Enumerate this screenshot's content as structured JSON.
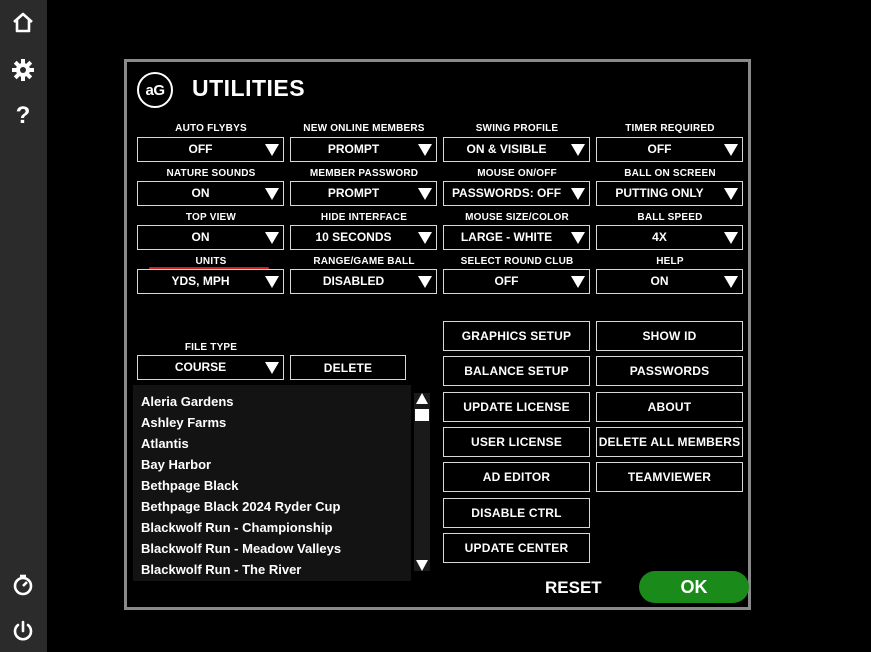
{
  "sidebar": {
    "icons": [
      "home-icon",
      "gear-icon",
      "help-icon",
      "timer-icon",
      "power-icon"
    ],
    "help_glyph": "?"
  },
  "header": {
    "logo_text": "aG",
    "title": "UTILITIES"
  },
  "settings": [
    {
      "label": "AUTO FLYBYS",
      "value": "OFF"
    },
    {
      "label": "NEW ONLINE MEMBERS",
      "value": "PROMPT"
    },
    {
      "label": "SWING PROFILE",
      "value": "ON & VISIBLE"
    },
    {
      "label": "TIMER REQUIRED",
      "value": "OFF"
    },
    {
      "label": "NATURE SOUNDS",
      "value": "ON"
    },
    {
      "label": "MEMBER PASSWORD",
      "value": "PROMPT"
    },
    {
      "label": "MOUSE ON/OFF",
      "value": "PASSWORDS: OFF"
    },
    {
      "label": "BALL ON SCREEN",
      "value": "PUTTING ONLY"
    },
    {
      "label": "TOP VIEW",
      "value": "ON"
    },
    {
      "label": "HIDE INTERFACE",
      "value": "10 SECONDS"
    },
    {
      "label": "MOUSE SIZE/COLOR",
      "value": "LARGE - WHITE"
    },
    {
      "label": "BALL SPEED",
      "value": "4X"
    },
    {
      "label": "UNITS",
      "value": "YDS, MPH"
    },
    {
      "label": "RANGE/GAME BALL",
      "value": "DISABLED"
    },
    {
      "label": "SELECT ROUND CLUB",
      "value": "OFF"
    },
    {
      "label": "HELP",
      "value": "ON"
    }
  ],
  "file_type": {
    "label": "FILE TYPE",
    "value": "COURSE",
    "delete_label": "DELETE"
  },
  "course_list": [
    "Aleria Gardens",
    "Ashley Farms",
    "Atlantis",
    "Bay Harbor",
    "Bethpage Black",
    "Bethpage Black 2024 Ryder Cup",
    "Blackwolf Run - Championship",
    "Blackwolf Run - Meadow Valleys",
    "Blackwolf Run - The River"
  ],
  "buttons_left": [
    "GRAPHICS SETUP",
    "BALANCE SETUP",
    "UPDATE LICENSE",
    "USER LICENSE",
    "AD EDITOR",
    "DISABLE CTRL",
    "UPDATE CENTER"
  ],
  "buttons_right": [
    "SHOW ID",
    "PASSWORDS",
    "ABOUT",
    "DELETE ALL MEMBERS",
    "TEAMVIEWER"
  ],
  "footer": {
    "reset_label": "RESET",
    "ok_label": "OK"
  },
  "colors": {
    "accent_ok": "#1a8a1a",
    "units_underline": "#d42020",
    "panel_border": "#8a8a8a",
    "sidebar": "#2b2b2b"
  }
}
